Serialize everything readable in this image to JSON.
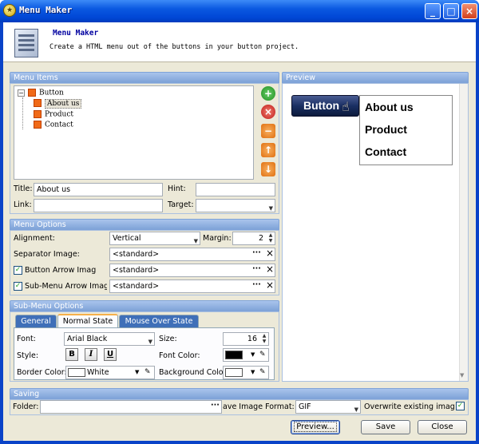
{
  "window": {
    "title": "Menu Maker",
    "app_icon": "star-icon",
    "controls": [
      "_",
      "□",
      "×"
    ]
  },
  "header": {
    "title": "Menu Maker",
    "subtitle": "Create a HTML menu out of the buttons in your button project."
  },
  "menu_items": {
    "group_title": "Menu Items",
    "tree": [
      {
        "label": "Button",
        "level": 0,
        "expander": "−"
      },
      {
        "label": "About us",
        "level": 1,
        "selected": true
      },
      {
        "label": "Product",
        "level": 1
      },
      {
        "label": "Contact",
        "level": 1
      }
    ],
    "side_buttons": [
      "add",
      "delete",
      "remove",
      "up",
      "down"
    ],
    "title_label": "Title:",
    "title_value": "About us",
    "hint_label": "Hint:",
    "hint_value": "",
    "link_label": "Link:",
    "link_value": "",
    "target_label": "Target:",
    "target_value": ""
  },
  "menu_options": {
    "group_title": "Menu Options",
    "alignment_label": "Alignment:",
    "alignment_value": "Vertical",
    "margin_label": "Margin:",
    "margin_value": "2",
    "separator_label": "Separator Image:",
    "separator_value": "<standard>",
    "button_arrow_label": "Button Arrow Imag",
    "button_arrow_value": "<standard>",
    "button_arrow_checked": true,
    "submenu_arrow_label": "Sub-Menu Arrow Imag",
    "submenu_arrow_value": "<standard>",
    "submenu_arrow_checked": true,
    "browse": "···",
    "clear": "×"
  },
  "submenu_options": {
    "group_title": "Sub-Menu Options",
    "tabs": [
      "General",
      "Normal State",
      "Mouse Over State"
    ],
    "active_tab": "Normal State",
    "font_label": "Font:",
    "font_value": "Arial Black",
    "size_label": "Size:",
    "size_value": "16",
    "style_label": "Style:",
    "style_buttons": [
      "B",
      "I",
      "U"
    ],
    "font_color_label": "Font Color:",
    "font_color": "#000000",
    "border_color_label": "Border Color:",
    "border_color_value": "White",
    "border_color": "#ffffff",
    "background_color_label": "Background Color",
    "background_color": "#ffffff"
  },
  "preview": {
    "group_title": "Preview",
    "button_label": "Button",
    "menu_items": [
      "About us",
      "Product",
      "Contact"
    ]
  },
  "saving": {
    "group_title": "Saving",
    "folder_label": "Folder:",
    "folder_value": "",
    "format_label": "ave Image Format:",
    "format_value": "GIF",
    "overwrite_label": "Overwrite existing image",
    "overwrite_checked": true
  },
  "footer": {
    "preview_button": "Preview...",
    "save_button": "Save",
    "close_button": "Close"
  },
  "colors": {
    "titlebar": "#0a58e0",
    "group_header": "#7fa3d8",
    "client_bg": "#ece9d8",
    "tree_marker": "#f06a18",
    "preview_button": "#1a2f63"
  }
}
